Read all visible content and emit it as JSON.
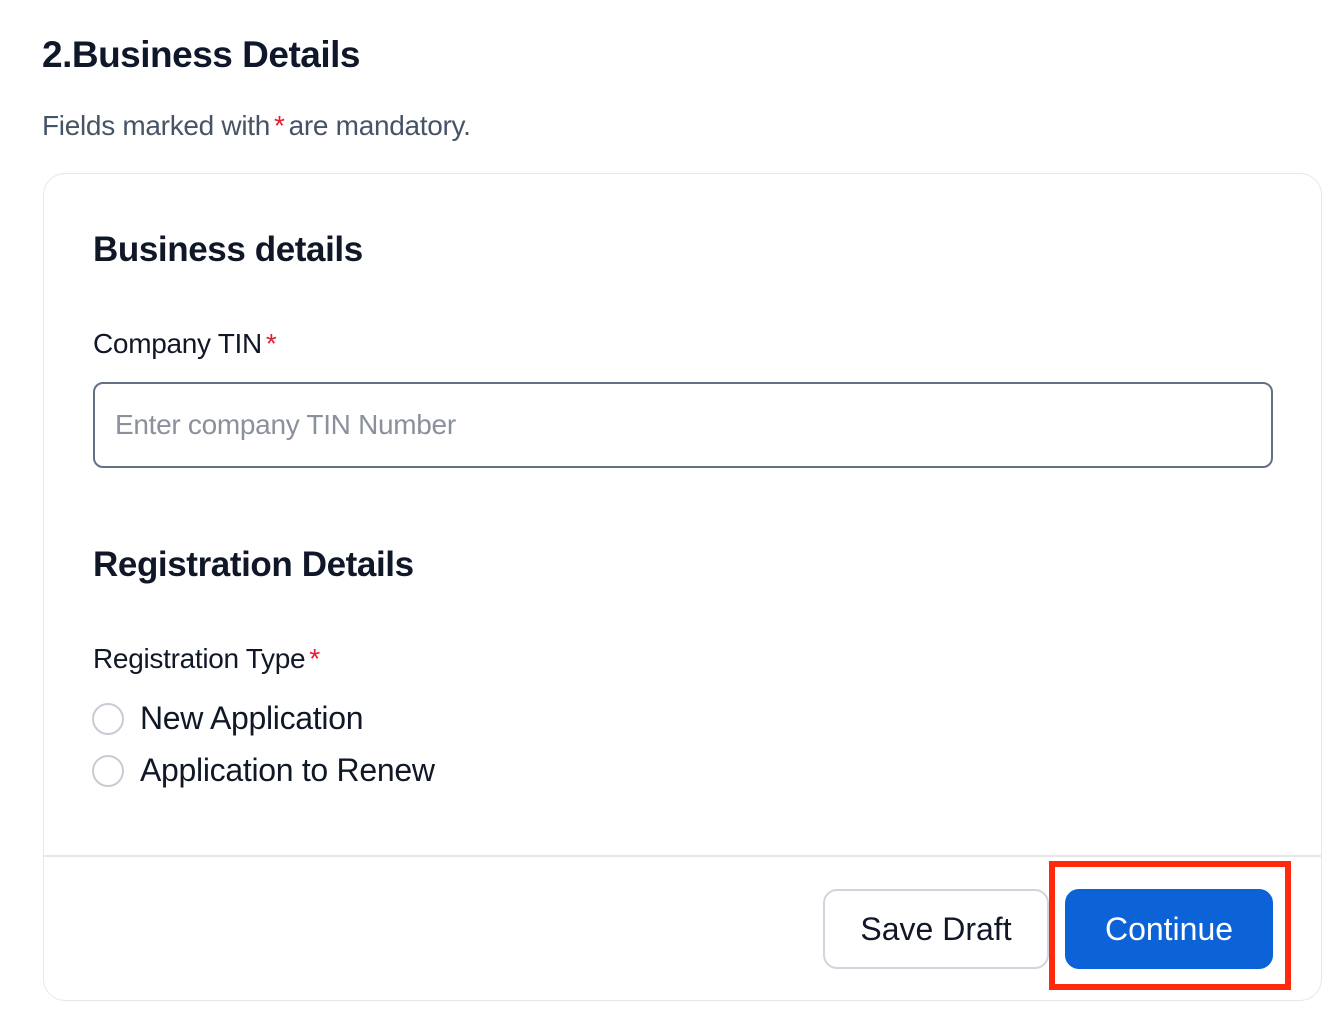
{
  "header": {
    "title": "2.Business Details",
    "note_prefix": "Fields marked with",
    "note_asterisk": "*",
    "note_suffix": "are mandatory."
  },
  "business_details": {
    "heading": "Business details",
    "company_tin": {
      "label": "Company TIN",
      "required_mark": "*",
      "value": "",
      "placeholder": "Enter company TIN Number"
    }
  },
  "registration_details": {
    "heading": "Registration Details",
    "registration_type": {
      "label": "Registration Type",
      "required_mark": "*",
      "options": [
        {
          "label": "New Application",
          "selected": false
        },
        {
          "label": "Application to Renew",
          "selected": false
        }
      ]
    }
  },
  "actions": {
    "save_draft_label": "Save Draft",
    "continue_label": "Continue"
  },
  "colors": {
    "primary": "#0b63d7",
    "required": "#e11d2e",
    "highlight": "#ff2a0d"
  }
}
